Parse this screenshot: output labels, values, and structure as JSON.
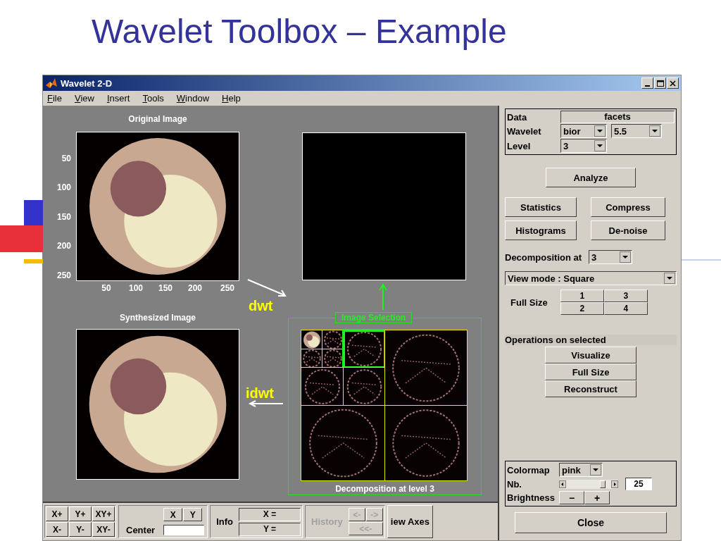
{
  "slide": {
    "title": "Wavelet Toolbox – Example"
  },
  "window": {
    "title": "Wavelet 2-D"
  },
  "menu": [
    "File",
    "View",
    "Insert",
    "Tools",
    "Window",
    "Help"
  ],
  "original_image": {
    "title": "Original Image",
    "yticks": [
      "50",
      "100",
      "150",
      "200",
      "250"
    ],
    "xticks": [
      "50",
      "100",
      "150",
      "200",
      "250"
    ]
  },
  "synthesized_image": {
    "title": "Synthesized Image"
  },
  "dwt_label": "dwt",
  "idwt_label": "idwt",
  "decomposition": {
    "selection_label": "Image Selection",
    "caption": "Decomposition at level 3",
    "tiles": [
      {
        "kind": "approximation",
        "selected": false
      },
      {
        "kind": "detail",
        "selected": false
      },
      {
        "kind": "detail",
        "selected": false
      },
      {
        "kind": "detail",
        "selected": false
      },
      {
        "kind": "detail",
        "selected": true
      },
      {
        "kind": "detail",
        "selected": false
      },
      {
        "kind": "detail",
        "selected": false
      },
      {
        "kind": "detail",
        "selected": false
      },
      {
        "kind": "detail",
        "selected": false
      },
      {
        "kind": "detail",
        "selected": false
      }
    ]
  },
  "toolbar": {
    "zoom_buttons": [
      "X+",
      "Y+",
      "XY+",
      "X-",
      "Y-",
      "XY-"
    ],
    "center": {
      "buttons": [
        "X",
        "Y"
      ],
      "label": "Center"
    },
    "info": {
      "label": "Info",
      "fields": [
        "X =",
        "Y ="
      ]
    },
    "history": {
      "label": "History",
      "disabled": true,
      "buttons": [
        "<-",
        "->",
        "<<-"
      ]
    },
    "view_axes": "iew Axes"
  },
  "panel": {
    "data": {
      "label": "Data",
      "value": "facets"
    },
    "wavelet": {
      "label": "Wavelet",
      "family": "bior",
      "order": "5.5"
    },
    "level": {
      "label": "Level",
      "value": "3"
    },
    "analyze": "Analyze",
    "tools": [
      "Statistics",
      "Compress",
      "Histograms",
      "De-noise"
    ],
    "decomposition_at": {
      "label": "Decomposition at",
      "value": "3"
    },
    "view_mode": "View mode : Square",
    "full_size": {
      "label": "Full Size",
      "buttons": [
        "1",
        "3",
        "2",
        "4"
      ]
    },
    "operations": {
      "label": "Operations on selected",
      "buttons": [
        "Visualize",
        "Full Size",
        "Reconstruct"
      ]
    },
    "colormap": {
      "label": "Colormap",
      "value": "pink"
    },
    "nb": {
      "label": "Nb.",
      "level": 0.75,
      "value": "25"
    },
    "brightness": {
      "label": "Brightness",
      "buttons": [
        "−",
        "+"
      ]
    },
    "close": "Close"
  }
}
